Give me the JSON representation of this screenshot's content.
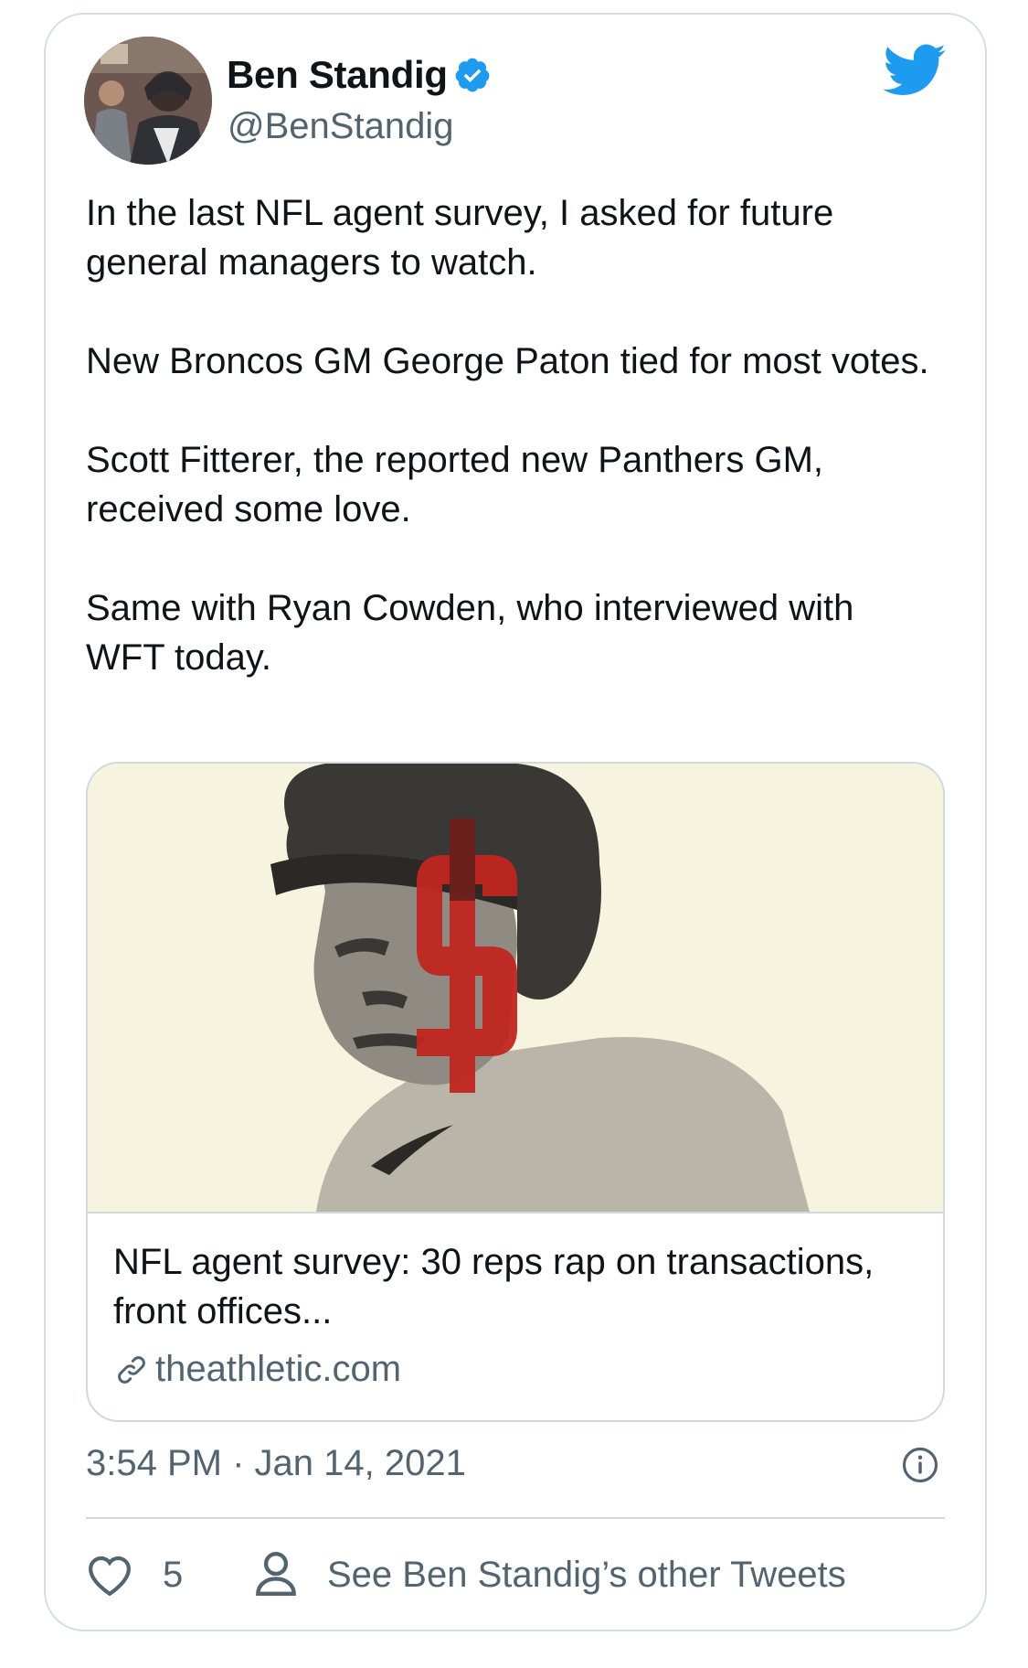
{
  "author": {
    "display_name": "Ben Standig",
    "handle": "@BenStandig",
    "verified": true
  },
  "tweet": {
    "paragraphs": [
      "In the last NFL agent survey, I asked for future general managers to watch.",
      "New Broncos GM George Paton tied for most votes.",
      "Scott Fitterer, the reported new Panthers GM, received some love.",
      "Same with Ryan Cowden, who interviewed with WFT today."
    ]
  },
  "link_card": {
    "title": "NFL agent survey: 30 reps rap on transactions, front offices...",
    "domain": "theathletic.com",
    "image_icon": "dollar-sign-illustration"
  },
  "meta": {
    "timestamp": "3:54 PM · Jan 14, 2021"
  },
  "actions": {
    "like_count": "5",
    "other_tweets_label": "See Ben Standig’s other Tweets"
  },
  "icons": {
    "brand": "twitter-bird-icon",
    "verified": "verified-badge-icon",
    "info": "info-icon",
    "like": "heart-icon",
    "profile": "person-icon",
    "link": "link-icon"
  },
  "colors": {
    "twitter_blue": "#1d9bf0",
    "text_primary": "#0f1419",
    "text_secondary": "#536471",
    "border": "#cfd9de",
    "media_background": "#f6f3df",
    "dollar_red": "#c0261f"
  }
}
